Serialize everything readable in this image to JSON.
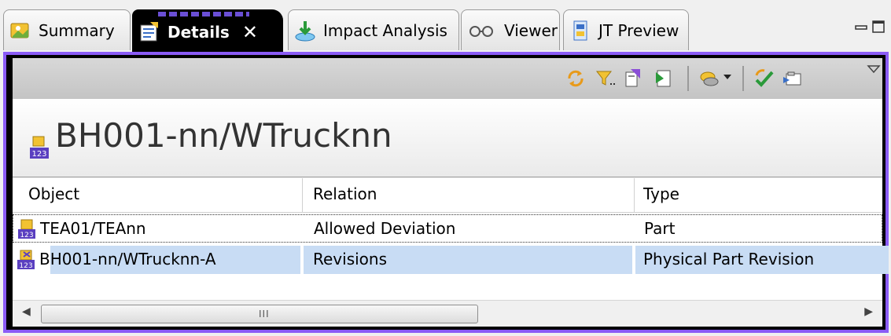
{
  "tabs": [
    {
      "label": "Summary",
      "icon": "summary-icon"
    },
    {
      "label": "Details",
      "icon": "details-icon",
      "active": true,
      "close": "✕"
    },
    {
      "label": "Impact Analysis",
      "icon": "impact-analysis-icon"
    },
    {
      "label": "Viewer",
      "icon": "viewer-icon"
    },
    {
      "label": "JT Preview",
      "icon": "jt-preview-icon"
    }
  ],
  "window_controls": {
    "minimize": "▭",
    "maximize": "▢"
  },
  "heading": {
    "title": "BH001-nn/WTrucknn",
    "icon": "item-revision-icon"
  },
  "table": {
    "columns": [
      "Object",
      "Relation",
      "Type"
    ],
    "rows": [
      {
        "object": "TEA01/TEAnn",
        "relation": "Allowed Deviation",
        "type": "Part",
        "icon": "part-icon"
      },
      {
        "object": "BH001-nn/WTrucknn-A",
        "relation": "Revisions",
        "type": "Physical Part Revision",
        "icon": "part-revision-icon",
        "selected": true
      }
    ]
  },
  "scrollbar": {
    "left": "◀",
    "right": "▶",
    "grip": "III"
  },
  "colors": {
    "accent": "#8b5cf6",
    "selection": "#c8dcf4",
    "tab_active": "#000000"
  }
}
